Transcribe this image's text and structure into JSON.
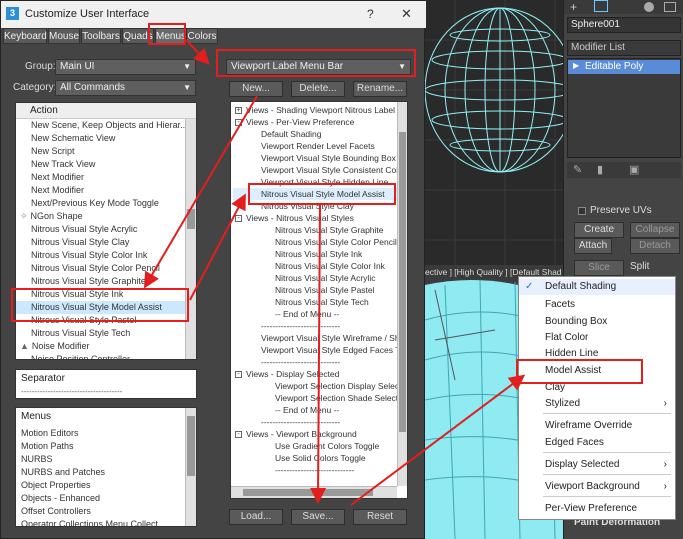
{
  "dialog": {
    "title": "Customize User Interface",
    "help": "?",
    "close": "✕",
    "tabs": [
      "Keyboard",
      "Mouse",
      "Toolbars",
      "Quads",
      "Menus",
      "Colors"
    ],
    "group_label": "Group:",
    "group_value": "Main UI",
    "category_label": "Category:",
    "category_value": "All Commands",
    "action_header": "Action",
    "actions": [
      "New Scene, Keep Objects and Hierar...",
      "New Schematic View",
      "New Script",
      "New Track View",
      "Next Modifier",
      "Next Modifier",
      "Next/Previous Key Mode Toggle",
      "NGon Shape",
      "Nitrous Visual Style Acrylic",
      "Nitrous Visual Style Clay",
      "Nitrous Visual Style Color Ink",
      "Nitrous Visual Style Color Pencil",
      "Nitrous Visual Style Graphite",
      "Nitrous Visual Style Ink",
      "Nitrous Visual Style Model Assist",
      "Nitrous Visual Style Pastel",
      "Nitrous Visual Style Tech",
      "Noise Modifier",
      "Noise Position Controller"
    ],
    "separator_label": "Separator",
    "separator_line": "--------------------------------------",
    "menus_header": "Menus",
    "menus": [
      "Motion Editors",
      "Motion Paths",
      "NURBS",
      "NURBS and Patches",
      "Object Properties",
      "Objects - Enhanced",
      "Offset Controllers",
      "Operator Collections Menu Collect"
    ],
    "menu_combo_value": "Viewport Label Menu Bar",
    "btn_new": "New...",
    "btn_delete": "Delete...",
    "btn_rename": "Rename...",
    "tree": [
      {
        "lvl": 0,
        "bx": "+",
        "text": "Views - Shading Viewport Nitrous Label M"
      },
      {
        "lvl": 0,
        "bx": "-",
        "text": "Views - Per-View Preference"
      },
      {
        "lvl": 1,
        "bx": "",
        "text": "Default Shading"
      },
      {
        "lvl": 1,
        "bx": "",
        "text": "Viewport Render Level Facets"
      },
      {
        "lvl": 1,
        "bx": "",
        "text": "Viewport Visual Style Bounding Box"
      },
      {
        "lvl": 1,
        "bx": "",
        "text": "Viewport Visual Style Consistent Colo"
      },
      {
        "lvl": 1,
        "bx": "",
        "text": "Viewport Visual Style Hidden Line"
      },
      {
        "lvl": 1,
        "bx": "",
        "text": "Nitrous Visual Style Model Assist"
      },
      {
        "lvl": 1,
        "bx": "",
        "text": "Nitrous Visual Style Clay"
      },
      {
        "lvl": 1,
        "bx": "-",
        "text": "Views - Nitrous Visual Styles"
      },
      {
        "lvl": 2,
        "bx": "",
        "text": "Nitrous Visual Style Graphite"
      },
      {
        "lvl": 2,
        "bx": "",
        "text": "Nitrous Visual Style Color Pencil"
      },
      {
        "lvl": 2,
        "bx": "",
        "text": "Nitrous Visual Style Ink"
      },
      {
        "lvl": 2,
        "bx": "",
        "text": "Nitrous Visual Style Color Ink"
      },
      {
        "lvl": 2,
        "bx": "",
        "text": "Nitrous Visual Style Acrylic"
      },
      {
        "lvl": 2,
        "bx": "",
        "text": "Nitrous Visual Style Pastel"
      },
      {
        "lvl": 2,
        "bx": "",
        "text": "Nitrous Visual Style Tech"
      },
      {
        "lvl": 2,
        "bx": "",
        "text": "-- End of Menu --"
      },
      {
        "lvl": 1,
        "bx": "",
        "text": "----------------------------"
      },
      {
        "lvl": 1,
        "bx": "",
        "text": "Viewport Visual Style Wireframe / Sh"
      },
      {
        "lvl": 1,
        "bx": "",
        "text": "Viewport Visual Style Edged Faces To"
      },
      {
        "lvl": 1,
        "bx": "",
        "text": "----------------------------"
      },
      {
        "lvl": 1,
        "bx": "-",
        "text": "Views - Display Selected"
      },
      {
        "lvl": 2,
        "bx": "",
        "text": "Viewport Selection Display Selec"
      },
      {
        "lvl": 2,
        "bx": "",
        "text": "Viewport Selection Shade Selecte"
      },
      {
        "lvl": 2,
        "bx": "",
        "text": "-- End of Menu --"
      },
      {
        "lvl": 1,
        "bx": "",
        "text": "----------------------------"
      },
      {
        "lvl": 1,
        "bx": "-",
        "text": "Views - Viewport Background"
      },
      {
        "lvl": 2,
        "bx": "",
        "text": "Use Gradient Colors Toggle"
      },
      {
        "lvl": 2,
        "bx": "",
        "text": "Use Solid Colors Toggle"
      },
      {
        "lvl": 2,
        "bx": "",
        "text": "----------------------------"
      }
    ],
    "btn_load": "Load...",
    "btn_save": "Save...",
    "btn_reset": "Reset"
  },
  "viewport": {
    "label": "ective ] [High Quality ] [Default Shad"
  },
  "right_panel": {
    "object_name": "Sphere001",
    "modifier_list": "Modifier List",
    "stack_item": "Editable Poly",
    "preserve_uvs": "Preserve UVs",
    "create": "Create",
    "collapse": "Collapse",
    "attach": "Attach",
    "detach": "Detach",
    "slice_plane": "Slice Plane",
    "split": "Split",
    "paint_deformation": "Paint Deformation"
  },
  "context_menu": {
    "items": [
      {
        "label": "Default Shading",
        "checked": true,
        "sub": false
      },
      {
        "label": "Facets",
        "checked": false,
        "sub": false
      },
      {
        "label": "Bounding Box",
        "checked": false,
        "sub": false
      },
      {
        "label": "Flat Color",
        "checked": false,
        "sub": false
      },
      {
        "label": "Hidden Line",
        "checked": false,
        "sub": false
      },
      {
        "label": "Model Assist",
        "checked": false,
        "sub": false
      },
      {
        "label": "Clay",
        "checked": false,
        "sub": false
      },
      {
        "label": "Stylized",
        "checked": false,
        "sub": true
      },
      {
        "label": "Wireframe Override",
        "checked": false,
        "sub": false
      },
      {
        "label": "Edged Faces",
        "checked": false,
        "sub": false
      },
      {
        "label": "Display Selected",
        "checked": false,
        "sub": true
      },
      {
        "label": "Viewport Background",
        "checked": false,
        "sub": true
      },
      {
        "label": "Per-View Preference",
        "checked": false,
        "sub": false
      }
    ],
    "check_mark": "✓",
    "sub_arrow": "›"
  },
  "colors": {
    "highlight_red": "#e21e1e",
    "selection_blue": "#cce8ff",
    "sphere_cyan": "#7fe8f0"
  }
}
